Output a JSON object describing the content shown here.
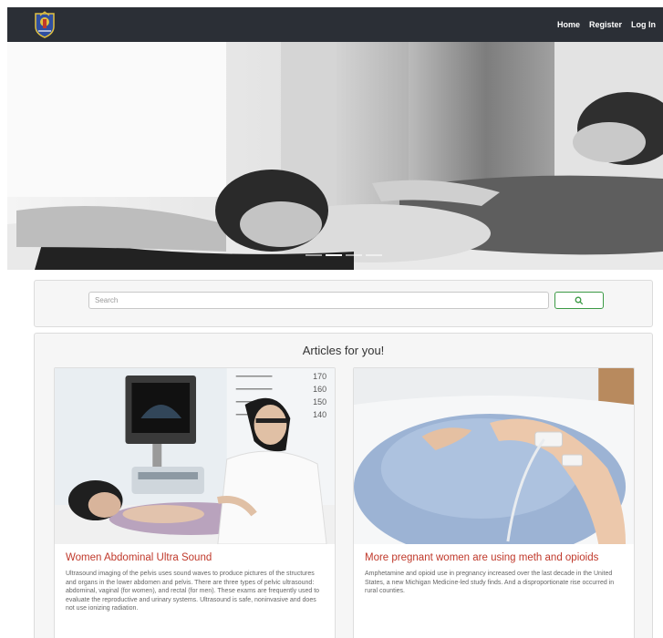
{
  "navbar": {
    "logo_icon": "crest-logo-icon",
    "links": [
      {
        "label": "Home"
      },
      {
        "label": "Register"
      },
      {
        "label": "Log In"
      }
    ]
  },
  "hero": {
    "slides_count": 4,
    "active_slide": 2
  },
  "search": {
    "placeholder": "Search",
    "value": "",
    "button_icon": "search-icon",
    "accent_color": "#3c9a45"
  },
  "articles": {
    "heading": "Articles for you!",
    "items": [
      {
        "title": "Women Abdominal Ultra Sound",
        "excerpt": "Ultrasound imaging of the pelvis uses sound waves to produce pictures of the structures and organs in the lower abdomen and pelvis. There are three types of pelvic ultrasound: abdominal, vaginal (for women), and rectal (for men). These exams are frequently used to evaluate the reproductive and urinary systems. Ultrasound is safe, noninvasive and does not use ionizing radiation."
      },
      {
        "title": "More pregnant women are using meth and opioids",
        "excerpt": "Amphetamine and opioid use in pregnancy increased over the last decade in the United States, a new Michigan Medicine-led study finds. And a disproportionate rise occurred in rural counties."
      }
    ]
  },
  "colors": {
    "navbar_bg": "#2b2f36",
    "title_red": "#c0392b"
  }
}
